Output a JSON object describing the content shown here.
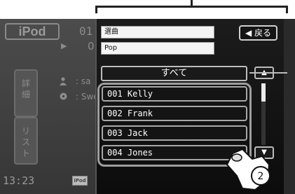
{
  "background": {
    "ipod_label": "iPod",
    "track_number": "01",
    "track_sub": "0",
    "play_glyph": "▶",
    "side_button_1": "詳\n細",
    "side_button_2": "リ\nス\nト",
    "artist_partial": ": sa",
    "song_partial": ": Swe",
    "clock": "13:23",
    "ipod_small": "iPod"
  },
  "panel": {
    "field_1": "選曲",
    "field_2": "Pop",
    "back_button": "◀ 戻る",
    "all_button": "すべて",
    "items": [
      "001 Kelly",
      "002 Frank",
      "003 Jack",
      "004 Jones"
    ],
    "scroll_up": "▲",
    "scroll_down": "▼"
  },
  "annotation": {
    "step_number": "2"
  },
  "colors": {
    "panel_bg": "#111111",
    "field_bg": "#f4f4f4",
    "frame": "#9e9e9e"
  }
}
